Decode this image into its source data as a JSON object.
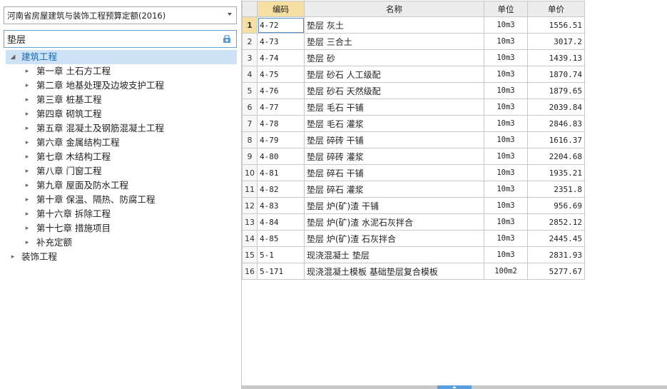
{
  "quota_select": {
    "value": "河南省房屋建筑与装饰工程预算定额(2016)"
  },
  "search": {
    "value": "垫层",
    "icon": "search-icon"
  },
  "tree": {
    "root": {
      "label": "建筑工程",
      "expanded": true,
      "selected": true
    },
    "chapters": [
      "第一章 土石方工程",
      "第二章 地基处理及边坡支护工程",
      "第三章 桩基工程",
      "第四章 砌筑工程",
      "第五章 混凝土及钢筋混凝土工程",
      "第六章 金属结构工程",
      "第七章 木结构工程",
      "第八章 门窗工程",
      "第九章 屋面及防水工程",
      "第十章 保温、隔热、防腐工程",
      "第十六章 拆除工程",
      "第十七章 措施项目",
      "补充定额"
    ],
    "root2": {
      "label": "装饰工程",
      "expanded": false
    }
  },
  "table": {
    "columns": {
      "code": "编码",
      "name": "名称",
      "unit": "单位",
      "price": "单价"
    },
    "active_row": 1,
    "rows": [
      {
        "no": "1",
        "code": "4-72",
        "name": "垫层 灰土",
        "unit": "10m3",
        "price": "1556.51"
      },
      {
        "no": "2",
        "code": "4-73",
        "name": "垫层 三合土",
        "unit": "10m3",
        "price": "3017.2"
      },
      {
        "no": "3",
        "code": "4-74",
        "name": "垫层 砂",
        "unit": "10m3",
        "price": "1439.13"
      },
      {
        "no": "4",
        "code": "4-75",
        "name": "垫层 砂石 人工级配",
        "unit": "10m3",
        "price": "1870.74"
      },
      {
        "no": "5",
        "code": "4-76",
        "name": "垫层 砂石 天然级配",
        "unit": "10m3",
        "price": "1879.65"
      },
      {
        "no": "6",
        "code": "4-77",
        "name": "垫层 毛石 干铺",
        "unit": "10m3",
        "price": "2039.84"
      },
      {
        "no": "7",
        "code": "4-78",
        "name": "垫层 毛石 灌浆",
        "unit": "10m3",
        "price": "2846.83"
      },
      {
        "no": "8",
        "code": "4-79",
        "name": "垫层 碎砖 干铺",
        "unit": "10m3",
        "price": "1616.37"
      },
      {
        "no": "9",
        "code": "4-80",
        "name": "垫层 碎砖 灌浆",
        "unit": "10m3",
        "price": "2204.68"
      },
      {
        "no": "10",
        "code": "4-81",
        "name": "垫层 碎石 干铺",
        "unit": "10m3",
        "price": "1935.21"
      },
      {
        "no": "11",
        "code": "4-82",
        "name": "垫层 碎石 灌浆",
        "unit": "10m3",
        "price": "2351.8"
      },
      {
        "no": "12",
        "code": "4-83",
        "name": "垫层 炉(矿)渣 干铺",
        "unit": "10m3",
        "price": "956.69"
      },
      {
        "no": "13",
        "code": "4-84",
        "name": "垫层 炉(矿)渣 水泥石灰拌合",
        "unit": "10m3",
        "price": "2852.12"
      },
      {
        "no": "14",
        "code": "4-85",
        "name": "垫层 炉(矿)渣 石灰拌合",
        "unit": "10m3",
        "price": "2445.45"
      },
      {
        "no": "15",
        "code": "5-1",
        "name": "现浇混凝土 垫层",
        "unit": "10m3",
        "price": "2831.93"
      },
      {
        "no": "16",
        "code": "5-171",
        "name": "现浇混凝土模板 基础垫层复合模板",
        "unit": "100m2",
        "price": "5277.67"
      }
    ]
  },
  "colors": {
    "header_code_bg": "#f6dfa3",
    "selection_bg": "#cde3f5",
    "accent": "#5a9fdc"
  }
}
